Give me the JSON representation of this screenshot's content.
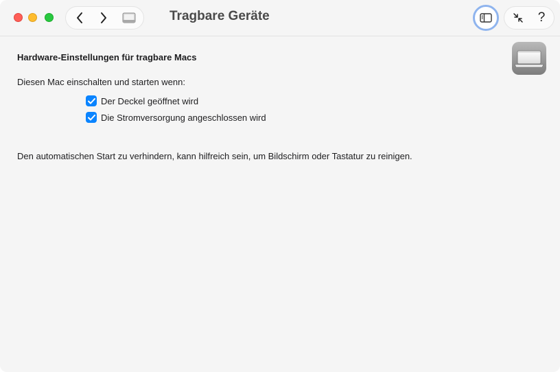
{
  "window": {
    "title": "Tragbare Geräte"
  },
  "toolbar": {
    "back_icon": "chevron-left-icon",
    "forward_icon": "chevron-right-icon",
    "book_icon": "book-icon",
    "sidebar_icon": "sidebar-icon",
    "collapse_icon": "collapse-arrows-icon",
    "help_label": "?"
  },
  "main": {
    "heading": "Hardware-Einstellungen für tragbare Macs",
    "prompt": "Diesen Mac einschalten und starten wenn:",
    "options": [
      {
        "label": "Der Deckel geöffnet wird",
        "checked": true
      },
      {
        "label": "Die Stromversorgung angeschlossen wird",
        "checked": true
      }
    ],
    "info": "Den automatischen Start zu verhindern, kann hilfreich sein, um Bildschirm oder Tastatur zu reinigen."
  },
  "colors": {
    "accent": "#0a84ff",
    "close": "#ff5f57",
    "minimize": "#febc2e",
    "maximize": "#28c840",
    "focus_ring": "#8fb4ee"
  }
}
